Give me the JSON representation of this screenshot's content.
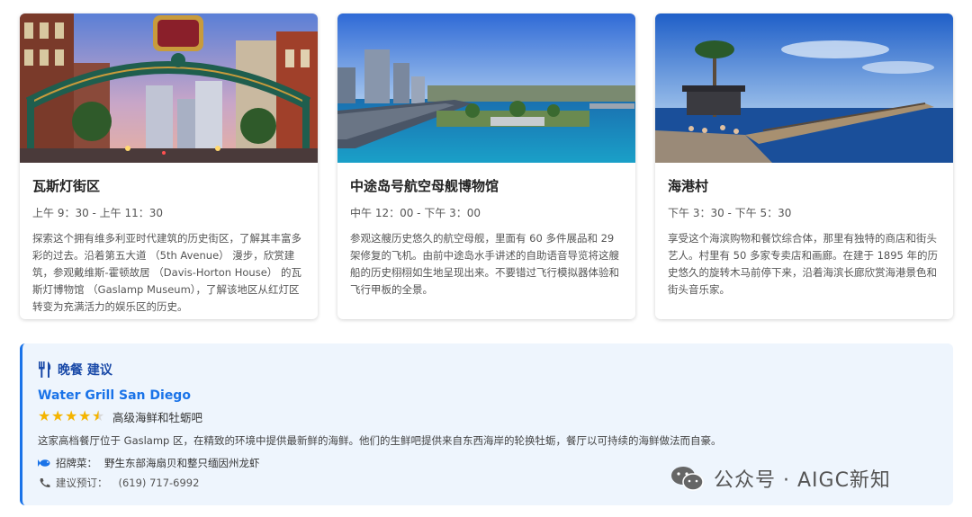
{
  "cards": [
    {
      "title": "瓦斯灯街区",
      "time": "上午 9：30 - 上午 11：30",
      "description": "探索这个拥有维多利亚时代建筑的历史街区，了解其丰富多彩的过去。沿着第五大道 （5th Avenue） 漫步，欣赏建筑，参观戴维斯-霍顿故居 （Davis-Horton House） 的瓦斯灯博物馆 （Gaslamp Museum），了解该地区从红灯区转变为充满活力的娱乐区的历史。",
      "photo_icon": "gaslamp-arch-photo"
    },
    {
      "title": "中途岛号航空母舰博物馆",
      "time": "中午 12：00 - 下午 3：00",
      "description": "参观这艘历史悠久的航空母舰，里面有 60 多件展品和 29 架修复的飞机。由前中途岛水手讲述的自助语音导览将这艘船的历史栩栩如生地呈现出来。不要错过飞行模拟器体验和飞行甲板的全景。",
      "photo_icon": "harbor-carrier-photo"
    },
    {
      "title": "海港村",
      "time": "下午 3：30 - 下午 5：30",
      "description": "享受这个海滨购物和餐饮综合体，那里有独特的商店和街头艺人。村里有 50 多家专卖店和画廊。在建于 1895 年的历史悠久的旋转木马前停下来，沿着海滨长廊欣赏海港景色和街头音乐家。",
      "photo_icon": "seaport-pier-photo"
    }
  ],
  "dinner": {
    "title": "晚餐 建议",
    "restaurant": "Water Grill San Diego",
    "rating": 4.5,
    "type": "高级海鲜和牡蛎吧",
    "description": "这家高档餐厅位于 Gaslamp 区，在精致的环境中提供最新鲜的海鲜。他们的生鲜吧提供来自东西海岸的轮换牡蛎，餐厅以可持续的海鲜做法而自豪。",
    "signature_label": "招牌菜：",
    "signature_value": "野生东部海扇贝和整只缅因州龙虾",
    "phone_label": "建议预订：",
    "phone_value": "(619) 717-6992"
  },
  "watermark": {
    "text": "公众号 · AIGC新知"
  },
  "colors": {
    "accent": "#1a73e8",
    "star": "#f4b400",
    "dinner_bg": "#eef5fd"
  }
}
